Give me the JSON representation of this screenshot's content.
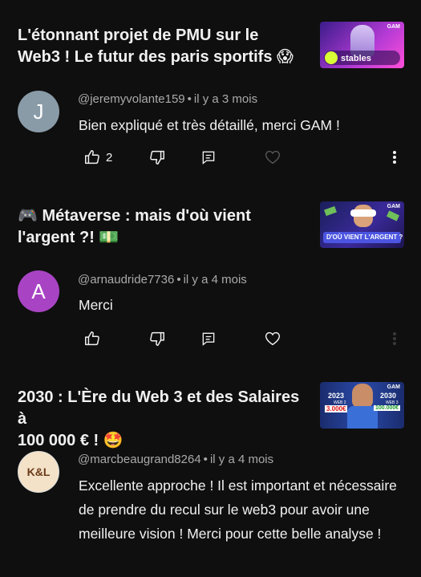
{
  "items": [
    {
      "title": "L'étonnant projet de PMU sur le\nWeb3 ! Le futur des paris sportifs 😱",
      "thumb": {
        "badge": "GAM",
        "caption": "stables"
      },
      "author": "@jeremyvolante159",
      "time": "il y a 3 mois",
      "avatar_letter": "J",
      "avatar_color": "#8a9ba8",
      "text": "Bien expliqué et très détaillé, merci GAM !",
      "likes": "2"
    },
    {
      "title": "🎮 Métaverse : mais d'où vient\nl'argent ?! 💵",
      "thumb": {
        "badge": "GAM",
        "caption": "D'OÙ VIENT L'ARGENT ?"
      },
      "author": "@arnaudride7736",
      "time": "il y a 4 mois",
      "avatar_letter": "A",
      "avatar_color": "#a844c4",
      "text": "Merci",
      "likes": ""
    },
    {
      "title": "2030 : L'Ère du Web 3 et des Salaires à\n100 000 € ! 🤩",
      "thumb": {
        "badge": "GAM",
        "left_year": "2023",
        "left_sub": "WEB 2",
        "left_amount": "3.000€",
        "right_year": "2030",
        "right_sub": "WEB 3",
        "right_amount": "100.000€"
      },
      "author": "@marcbeaugrand8264",
      "time": "il y a 4 mois",
      "avatar_letter": "K&L",
      "avatar_color": "#f3e2c7",
      "text": "Excellente approche ! Il est important et nécessaire de prendre du recul sur le web3 pour avoir une meilleure vision ! Merci pour cette belle analyse !"
    }
  ],
  "colors": {
    "bg": "#0f0f0f",
    "text": "#f1f1f1",
    "meta": "#aaaaaa"
  },
  "icons": [
    "thumb-up-icon",
    "thumb-down-icon",
    "reply-icon",
    "heart-icon",
    "more-vert-icon"
  ]
}
